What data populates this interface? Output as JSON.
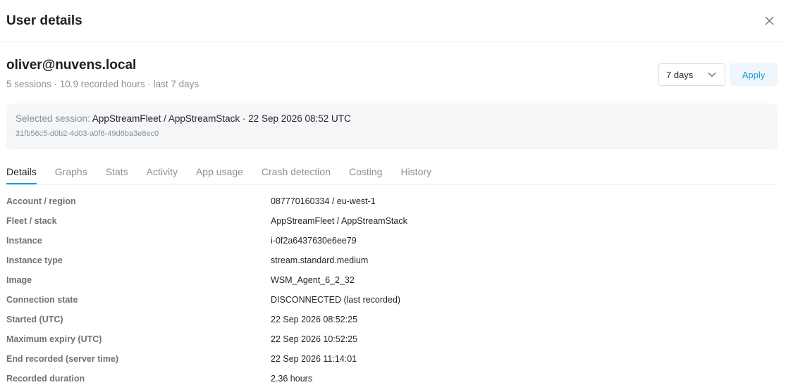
{
  "header": {
    "title": "User details"
  },
  "user": {
    "email": "oliver@nuvens.local",
    "summary": "5 sessions · 10.9 recorded hours · last 7 days"
  },
  "controls": {
    "range_value": "7 days",
    "apply_label": "Apply"
  },
  "session": {
    "label": "Selected session:",
    "value": "AppStreamFleet / AppStreamStack · 22 Sep 2026 08:52 UTC",
    "id": "31fb56c5-d0b2-4d03-a0f6-49d6ba3e8ec0"
  },
  "tabs": [
    {
      "label": "Details",
      "active": true
    },
    {
      "label": "Graphs"
    },
    {
      "label": "Stats"
    },
    {
      "label": "Activity"
    },
    {
      "label": "App usage"
    },
    {
      "label": "Crash detection"
    },
    {
      "label": "Costing"
    },
    {
      "label": "History"
    }
  ],
  "details": [
    {
      "key": "Account / region",
      "value": "087770160334 / eu-west-1"
    },
    {
      "key": "Fleet / stack",
      "value": "AppStreamFleet / AppStreamStack"
    },
    {
      "key": "Instance",
      "value": "i-0f2a6437630e6ee79"
    },
    {
      "key": "Instance type",
      "value": "stream.standard.medium"
    },
    {
      "key": "Image",
      "value": "WSM_Agent_6_2_32"
    },
    {
      "key": "Connection state",
      "value": "DISCONNECTED (last recorded)"
    },
    {
      "key": "Started (UTC)",
      "value": "22 Sep 2026 08:52:25"
    },
    {
      "key": "Maximum expiry (UTC)",
      "value": "22 Sep 2026 10:52:25"
    },
    {
      "key": "End recorded (server time)",
      "value": "22 Sep 2026 11:14:01"
    },
    {
      "key": "Recorded duration",
      "value": "2.36 hours"
    }
  ],
  "colors": {
    "accent": "#1a9bd6",
    "muted": "#8a9099",
    "panel": "#f5f6f7"
  },
  "icons": {
    "close": "close-icon",
    "dropdown": "chevron-down-icon"
  }
}
